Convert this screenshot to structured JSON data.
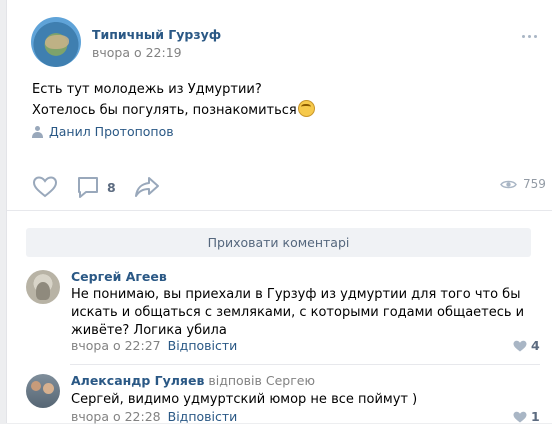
{
  "post": {
    "group_name": "Типичный Гурзуф",
    "time": "вчора о 22:19",
    "text_line1": "Есть тут молодежь из Удмуртии?",
    "text_line2": "Хотелось бы погулять, познакомиться",
    "signer": "Данил Протопопов",
    "comments_count": "8",
    "views": "759"
  },
  "hide_comments_label": "Приховати коментарі",
  "comments": [
    {
      "author": "Сергей Агеев",
      "reply_to": "",
      "text": "Не понимаю, вы приехали в Гурзуф из удмуртии для того что бы искать и общаться с земляками, с которыми годами общаетесь и живёте? Логика убила",
      "time": "вчора о 22:27",
      "reply_label": "Відповісти",
      "likes": "4"
    },
    {
      "author": "Александр Гуляев",
      "reply_to": "відповів Сергею",
      "text": "Сергей, видимо удмуртский юмор не все поймут )",
      "time": "вчора о 22:28",
      "reply_label": "Відповісти",
      "likes": "1"
    }
  ],
  "colors": {
    "link": "#2a5885",
    "muted": "#828282",
    "icon": "#a9b6c5",
    "background": "#edeef0"
  },
  "icons": [
    "heart-icon",
    "comment-icon",
    "share-icon",
    "eye-icon",
    "more-icon",
    "person-icon"
  ]
}
